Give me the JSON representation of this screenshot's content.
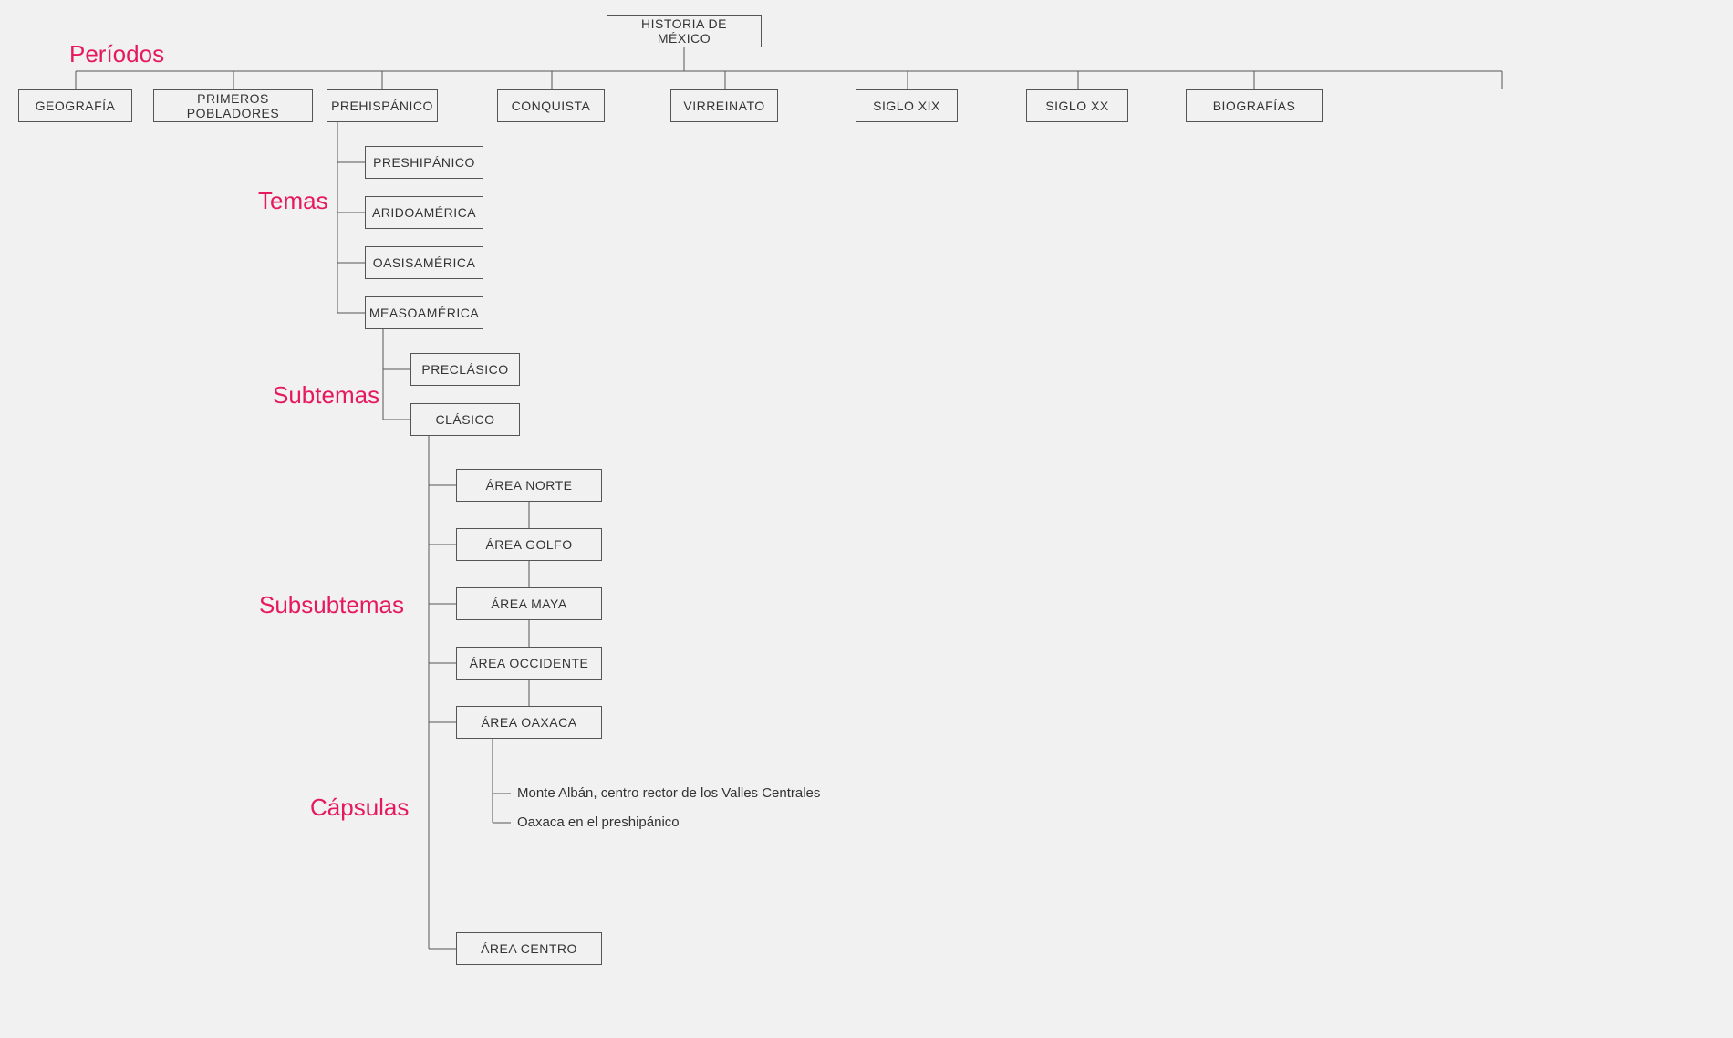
{
  "root": "HISTORIA DE MÉXICO",
  "periods": [
    "GEOGRAFÍA",
    "PRIMEROS POBLADORES",
    "PREHISPÁNICO",
    "CONQUISTA",
    "VIRREINATO",
    "SIGLO XIX",
    "SIGLO XX",
    "BIOGRAFÍAS"
  ],
  "temas": [
    "PRESHIPÁNICO",
    "ARIDOAMÉRICA",
    "OASISAMÉRICA",
    "MEASOAMÉRICA"
  ],
  "subtemas": [
    "PRECLÁSICO",
    "CLÁSICO"
  ],
  "subsubtemas": [
    "ÁREA NORTE",
    "ÁREA GOLFO",
    "ÁREA MAYA",
    "ÁREA OCCIDENTE",
    "ÁREA OAXACA",
    "ÁREA CENTRO"
  ],
  "capsulas": [
    "Monte Albán, centro rector de los Valles Centrales",
    "Oaxaca en el preshipánico"
  ],
  "labels": {
    "periodos": "Períodos",
    "temas": "Temas",
    "subtemas": "Subtemas",
    "subsubtemas": "Subsubtemas",
    "capsulas": "Cápsulas"
  }
}
